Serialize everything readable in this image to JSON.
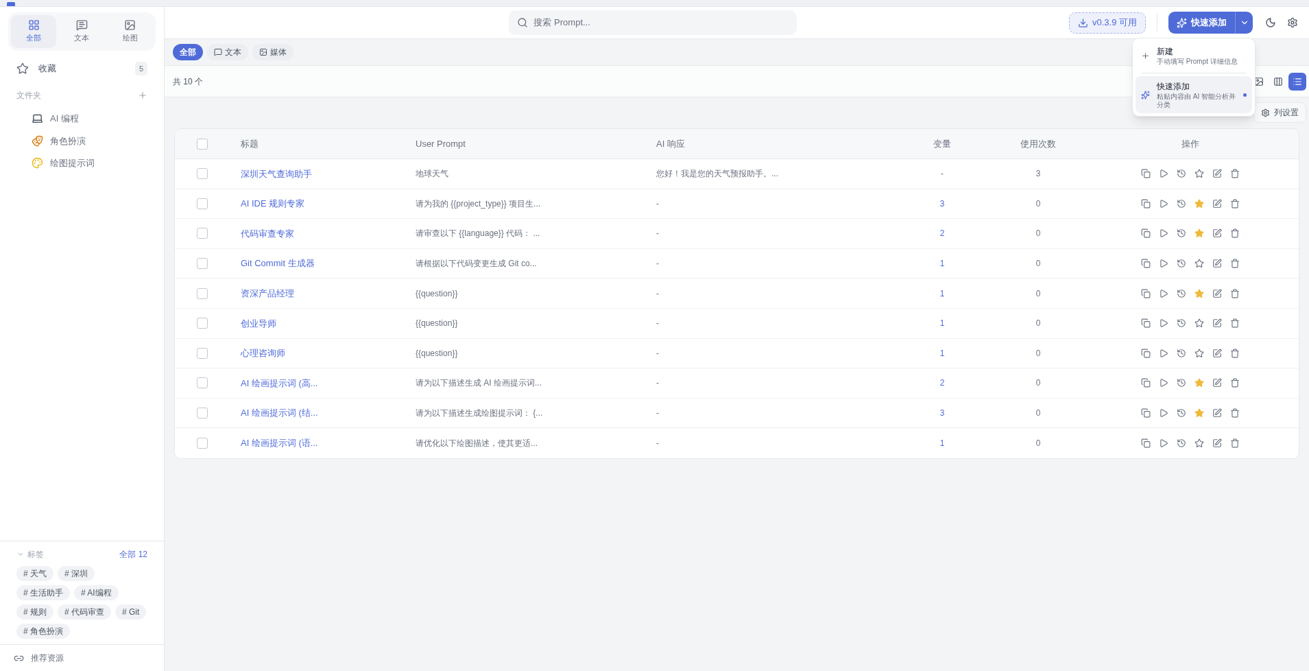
{
  "sidebar": {
    "categories": [
      {
        "label": "全部",
        "kind": "grid",
        "selected": true
      },
      {
        "label": "文本",
        "kind": "message",
        "selected": false
      },
      {
        "label": "绘图",
        "kind": "image",
        "selected": false
      }
    ],
    "favorites": {
      "label": "收藏",
      "count": "5"
    },
    "folders_header": "文件夹",
    "folders": [
      {
        "label": "AI 编程",
        "kind": "laptop"
      },
      {
        "label": "角色扮演",
        "kind": "mask"
      },
      {
        "label": "绘图提示词",
        "kind": "palette"
      }
    ],
    "tags_section": {
      "title": "标签",
      "expanded": true,
      "all_link": "全部 12",
      "tags": [
        "# 天气",
        "# 深圳",
        "# 生活助手",
        "# AI编程",
        "# 规则",
        "# 代码审查",
        "# Git",
        "# 角色扮演"
      ]
    },
    "footer_link": "推荐资源"
  },
  "header": {
    "search": {
      "placeholder": "搜索 Prompt..."
    },
    "update_button": "v0.3.9 可用",
    "quick_add_button": "快速添加"
  },
  "filter_tabs": [
    {
      "label": "全部",
      "kind": "all",
      "selected": true
    },
    {
      "label": "文本",
      "kind": "text",
      "selected": false
    },
    {
      "label": "媒体",
      "kind": "media",
      "selected": false
    }
  ],
  "count_label": "共 10 个",
  "view_modes": [
    {
      "kind": "gallery",
      "selected": false
    },
    {
      "kind": "columns",
      "selected": false
    },
    {
      "kind": "list",
      "selected": true
    }
  ],
  "column_settings_button": "列设置",
  "dropdown_menu": [
    {
      "kind": "plus",
      "title": "新建",
      "description": "手动填写 Prompt 详细信息",
      "highlighted": false
    },
    {
      "kind": "sparkles",
      "title": "快速添加",
      "description": "粘贴内容由 AI 智能分析并分类",
      "highlighted": true
    }
  ],
  "table": {
    "select_all_checked": false,
    "columns": [
      "标题",
      "User Prompt",
      "AI 响应",
      "变量",
      "使用次数",
      "操作"
    ],
    "rows": [
      {
        "selected": false,
        "title": "深圳天气查询助手",
        "user_prompt": "地球天气",
        "ai_response": "您好！我是您的天气预报助手。...",
        "variables": "-",
        "variables_linked": false,
        "uses": "3",
        "favorite": false
      },
      {
        "selected": false,
        "title": "AI IDE 规则专家",
        "user_prompt": "请为我的 {{project_type}} 项目生...",
        "ai_response": "-",
        "variables": "3",
        "variables_linked": true,
        "uses": "0",
        "favorite": true
      },
      {
        "selected": false,
        "title": "代码审查专家",
        "user_prompt": "请审查以下 {{language}} 代码： ...",
        "ai_response": "-",
        "variables": "2",
        "variables_linked": true,
        "uses": "0",
        "favorite": true
      },
      {
        "selected": false,
        "title": "Git Commit 生成器",
        "user_prompt": "请根据以下代码变更生成 Git co...",
        "ai_response": "-",
        "variables": "1",
        "variables_linked": true,
        "uses": "0",
        "favorite": false
      },
      {
        "selected": false,
        "title": "资深产品经理",
        "user_prompt": "{{question}}",
        "ai_response": "-",
        "variables": "1",
        "variables_linked": true,
        "uses": "0",
        "favorite": true
      },
      {
        "selected": false,
        "title": "创业导师",
        "user_prompt": "{{question}}",
        "ai_response": "-",
        "variables": "1",
        "variables_linked": true,
        "uses": "0",
        "favorite": false
      },
      {
        "selected": false,
        "title": "心理咨询师",
        "user_prompt": "{{question}}",
        "ai_response": "-",
        "variables": "1",
        "variables_linked": true,
        "uses": "0",
        "favorite": false
      },
      {
        "selected": false,
        "title": "AI 绘画提示词 (高...",
        "user_prompt": "请为以下描述生成 AI 绘画提示词...",
        "ai_response": "-",
        "variables": "2",
        "variables_linked": true,
        "uses": "0",
        "favorite": true
      },
      {
        "selected": false,
        "title": "AI 绘画提示词 (结...",
        "user_prompt": "请为以下描述生成绘图提示词： {...",
        "ai_response": "-",
        "variables": "3",
        "variables_linked": true,
        "uses": "0",
        "favorite": true
      },
      {
        "selected": false,
        "title": "AI 绘画提示词 (语...",
        "user_prompt": "请优化以下绘图描述，使其更适...",
        "ai_response": "-",
        "variables": "1",
        "variables_linked": true,
        "uses": "0",
        "favorite": false
      }
    ]
  }
}
